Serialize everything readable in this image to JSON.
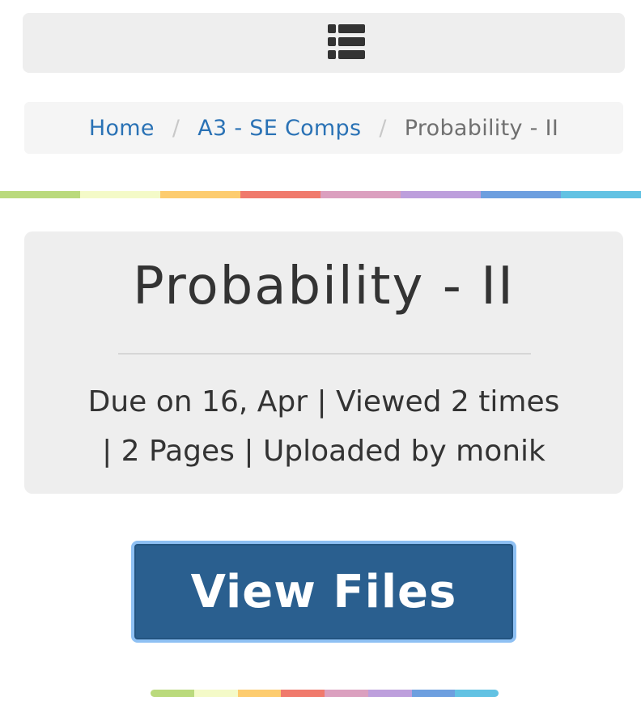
{
  "nav": {
    "toggle_icon": "list-icon"
  },
  "breadcrumb": {
    "items": [
      {
        "label": "Home",
        "link": true
      },
      {
        "label": "A3 - SE Comps",
        "link": true
      },
      {
        "label": "Probability - II",
        "link": false
      }
    ],
    "separator": "/"
  },
  "document": {
    "title": "Probability - II",
    "meta_line_1": "Due on 16, Apr | Viewed 2 times",
    "meta_line_2": "| 2 Pages | Uploaded by monik"
  },
  "actions": {
    "view_files_label": "View Files"
  },
  "colors": {
    "link": "#2a72b5",
    "button_bg": "#2a5f8f",
    "button_border": "#8ec0f3",
    "rainbow": [
      "#bada7c",
      "#f4fac8",
      "#fdcc6f",
      "#f07a6c",
      "#dba0bf",
      "#bd9fdc",
      "#6d9fdf",
      "#62c2e3"
    ]
  }
}
